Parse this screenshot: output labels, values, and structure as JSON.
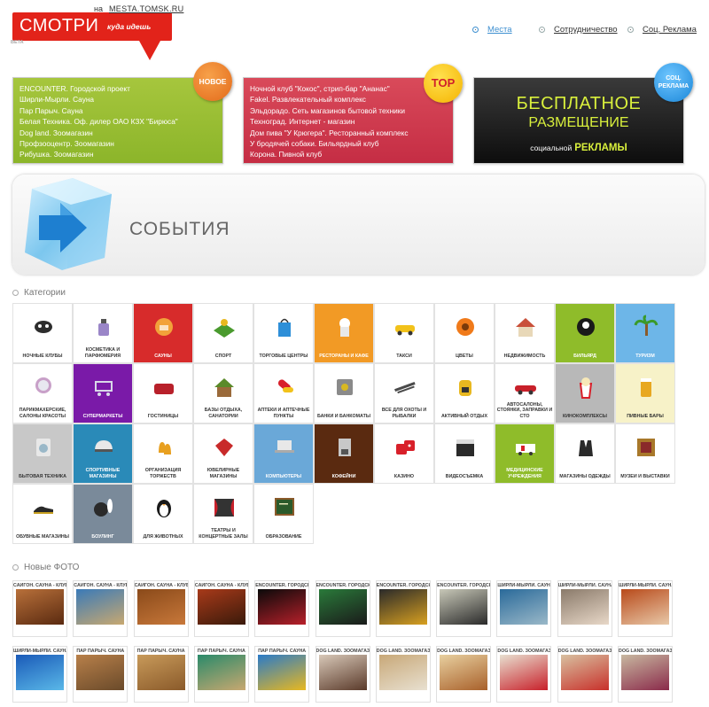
{
  "header": {
    "logo_word": "СМОТРИ",
    "logo_tag": "куда идешь",
    "beta": "BETA",
    "site_prefix": "на",
    "site_url": "MESTA.TOMSK.RU",
    "nav": [
      {
        "label": "Места",
        "active": true
      },
      {
        "label": "Сотрудничество",
        "active": false
      },
      {
        "label": "Соц. Реклама",
        "active": false
      }
    ]
  },
  "promo_new": {
    "badge": "НОВОЕ",
    "items": [
      "ENCOUNTER. Городской проект",
      "Ширли-Мырли. Сауна",
      "Пар Парыч. Сауна",
      "Белая Техника. Оф. дилер ОАО КЗХ \"Бирюса\"",
      "Dog land. Зоомагазин",
      "Профзооцентр. Зоомагазин",
      "Рибушка. Зоомагазин"
    ]
  },
  "promo_top": {
    "badge": "TOP",
    "items": [
      "Ночной клуб \"Кокос\", стрип-бар \"Ананас\"",
      "Fakel. Развлекательный комплекс",
      "Эльдорадо. Сеть магазинов бытовой техники",
      "Техноград. Интернет - магазин",
      "Дом пива \"У Крюгера\". Ресторанный комплекс",
      "У бродячей собаки. Бильярдный клуб",
      "Корона. Пивной клуб"
    ]
  },
  "promo_free": {
    "badge_line1": "СОЦ.",
    "badge_line2": "РЕКЛАМА",
    "line1": "БЕСПЛАТНОЕ",
    "line2": "РАЗМЕЩЕНИЕ",
    "line3_small": "социальной",
    "line3_big": "РЕКЛАМЫ"
  },
  "events": {
    "title": "СОБЫТИЯ"
  },
  "sections": {
    "categories": "Категории",
    "photos": "Новые ФОТО"
  },
  "categories": [
    {
      "label": "Ночные клубы",
      "icon": "mask-icon",
      "bg": "",
      "color": "#2d2d2d"
    },
    {
      "label": "Косметика и парфюмерия",
      "icon": "perfume-icon",
      "bg": "#ffffff",
      "color": "#9a86c8"
    },
    {
      "label": "Сауны",
      "icon": "sauna-icon",
      "bg": "#d72b2b",
      "color": "#f2a23a"
    },
    {
      "label": "Спорт",
      "icon": "stadium-icon",
      "bg": "",
      "color": "#4a9a2e"
    },
    {
      "label": "Торговые центры",
      "icon": "shopping-bag-icon",
      "bg": "",
      "color": "#2e8fd8"
    },
    {
      "label": "Рестораны и кафе",
      "icon": "chef-icon",
      "bg": "#f29a25",
      "color": "#ffffff"
    },
    {
      "label": "Такси",
      "icon": "taxi-icon",
      "bg": "",
      "color": "#f2c21a"
    },
    {
      "label": "Цветы",
      "icon": "flower-icon",
      "bg": "",
      "color": "#f07a1a"
    },
    {
      "label": "Недвижимость",
      "icon": "house-icon",
      "bg": "",
      "color": "#c9503a"
    },
    {
      "label": "Бильярд",
      "icon": "billiard-ball-icon",
      "bg": "#8fbc2a",
      "color": "#1a1a1a"
    },
    {
      "label": "Туризм",
      "icon": "palm-icon",
      "bg": "#6db6e8",
      "color": "#3a9a2a"
    },
    {
      "label": "Парикмахерские, салоны красоты",
      "icon": "mirror-icon",
      "bg": "",
      "color": "#c8a0c8"
    },
    {
      "label": "Супермаркеты",
      "icon": "cart-icon",
      "bg": "#7a1aa8",
      "color": "#d8d8e8"
    },
    {
      "label": "Гостиницы",
      "icon": "sofa-icon",
      "bg": "",
      "color": "#b8202a"
    },
    {
      "label": "Базы отдыха, санатории",
      "icon": "cabin-icon",
      "bg": "",
      "color": "#9a6a3a"
    },
    {
      "label": "Аптеки и аптечные пункты",
      "icon": "pill-icon",
      "bg": "",
      "color": "#d8202a"
    },
    {
      "label": "Банки и банкоматы",
      "icon": "safe-icon",
      "bg": "",
      "color": "#8a8a8a"
    },
    {
      "label": "Все для охоты и рыбалки",
      "icon": "rifle-icon",
      "bg": "",
      "color": "#4a4a4a"
    },
    {
      "label": "Активный отдых",
      "icon": "backpack-icon",
      "bg": "",
      "color": "#e8b820"
    },
    {
      "label": "Автосалоны, стоянки, заправки и СТО",
      "icon": "car-icon",
      "bg": "",
      "color": "#c8202a"
    },
    {
      "label": "Кинокомплексы",
      "icon": "popcorn-icon",
      "bg": "#b8b8b8",
      "color": "#d8202a"
    },
    {
      "label": "Пивные бары",
      "icon": "beer-icon",
      "bg": "#f7f2c8",
      "color": "#e8a820"
    },
    {
      "label": "Бытовая техника",
      "icon": "washer-icon",
      "bg": "#c8c8c8",
      "color": "#e8e8e8"
    },
    {
      "label": "Спортивные магазины",
      "icon": "helmet-icon",
      "bg": "#2a8ab8",
      "color": "#e8e8e8"
    },
    {
      "label": "Организация торжеств",
      "icon": "bells-icon",
      "bg": "",
      "color": "#e8a020"
    },
    {
      "label": "Ювелирные магазины",
      "icon": "gem-icon",
      "bg": "",
      "color": "#c82a2a"
    },
    {
      "label": "Компьютеры",
      "icon": "laptop-icon",
      "bg": "#6aa8d8",
      "color": "#e8e8e8"
    },
    {
      "label": "Кофейни",
      "icon": "coffee-machine-icon",
      "bg": "#5a2a10",
      "color": "#c8c8c8"
    },
    {
      "label": "Казино",
      "icon": "dice-icon",
      "bg": "",
      "color": "#d8202a"
    },
    {
      "label": "Видеосъемка",
      "icon": "clapper-icon",
      "bg": "",
      "color": "#2a2a2a"
    },
    {
      "label": "Медицинские учреждения",
      "icon": "ambulance-icon",
      "bg": "#8fbc2a",
      "color": "#ffffff"
    },
    {
      "label": "Магазины одежды",
      "icon": "suit-icon",
      "bg": "",
      "color": "#2a2a2a"
    },
    {
      "label": "Музеи и выставки",
      "icon": "frame-icon",
      "bg": "",
      "color": "#a8782a"
    },
    {
      "label": "Обувные магазины",
      "icon": "shoe-icon",
      "bg": "",
      "color": "#2a2a2a"
    },
    {
      "label": "Боулинг",
      "icon": "bowling-icon",
      "bg": "#7a8a9a",
      "color": "#2a2a2a"
    },
    {
      "label": "Для животных",
      "icon": "penguin-icon",
      "bg": "",
      "color": "#1a1a1a"
    },
    {
      "label": "Театры и концертные залы",
      "icon": "stage-icon",
      "bg": "",
      "color": "#c8202a"
    },
    {
      "label": "Образование",
      "icon": "chalkboard-icon",
      "bg": "",
      "color": "#2a5a2a"
    }
  ],
  "photos": [
    {
      "caption": "Сайгон. Сауна - клуб",
      "c1": "#b8703a",
      "c2": "#5a2a10"
    },
    {
      "caption": "Сайгон. Сауна - клуб",
      "c1": "#3a7ab8",
      "c2": "#c8a870"
    },
    {
      "caption": "Сайгон. Сауна - клуб",
      "c1": "#8a4a1a",
      "c2": "#c8783a"
    },
    {
      "caption": "Сайгон. Сауна - клуб",
      "c1": "#a83a1a",
      "c2": "#3a1a0a"
    },
    {
      "caption": "ENCOUNTER. Городской проект",
      "c1": "#0a0a0a",
      "c2": "#b8202a"
    },
    {
      "caption": "ENCOUNTER. Городской проект",
      "c1": "#2a7a3a",
      "c2": "#1a1a1a"
    },
    {
      "caption": "ENCOUNTER. Городской проект",
      "c1": "#2a2a2a",
      "c2": "#d8a020"
    },
    {
      "caption": "ENCOUNTER. Городской проект",
      "c1": "#c8c8b8",
      "c2": "#2a2a2a"
    },
    {
      "caption": "Ширли-Мырли. Сауна",
      "c1": "#2a6a9a",
      "c2": "#9ab8c8"
    },
    {
      "caption": "Ширли-Мырли. Сауна",
      "c1": "#8a7a6a",
      "c2": "#e8d8c8"
    },
    {
      "caption": "Ширли-Мырли. Сауна",
      "c1": "#b84a1a",
      "c2": "#e8c8a8"
    },
    {
      "caption": "Ширли-Мырли. Сауна",
      "c1": "#1a5ab8",
      "c2": "#5ab8e8"
    },
    {
      "caption": "Пар Парыч. Сауна",
      "c1": "#b8804a",
      "c2": "#6a4a2a"
    },
    {
      "caption": "Пар Парыч. Сауна",
      "c1": "#c89a5a",
      "c2": "#8a5a2a"
    },
    {
      "caption": "Пар Парыч. Сауна",
      "c1": "#2a8a6a",
      "c2": "#c8a870"
    },
    {
      "caption": "Пар Парыч. Сауна",
      "c1": "#2a7ac8",
      "c2": "#e8b820"
    },
    {
      "caption": "Dog land. Зоомагазин",
      "c1": "#d8c8b8",
      "c2": "#5a3a2a"
    },
    {
      "caption": "Dog land. Зоомагазин",
      "c1": "#c8a878",
      "c2": "#e8e0d0"
    },
    {
      "caption": "Dog land. Зоомагазин",
      "c1": "#e8d0a0",
      "c2": "#a8602a"
    },
    {
      "caption": "Dog land. Зоомагазин",
      "c1": "#e8e0d0",
      "c2": "#c8202a"
    },
    {
      "caption": "Dog land. Зоомагазин",
      "c1": "#d8c0a0",
      "c2": "#c8302a"
    },
    {
      "caption": "Dog land. Зоомагазин",
      "c1": "#c8b8a0",
      "c2": "#8a2a4a"
    }
  ]
}
